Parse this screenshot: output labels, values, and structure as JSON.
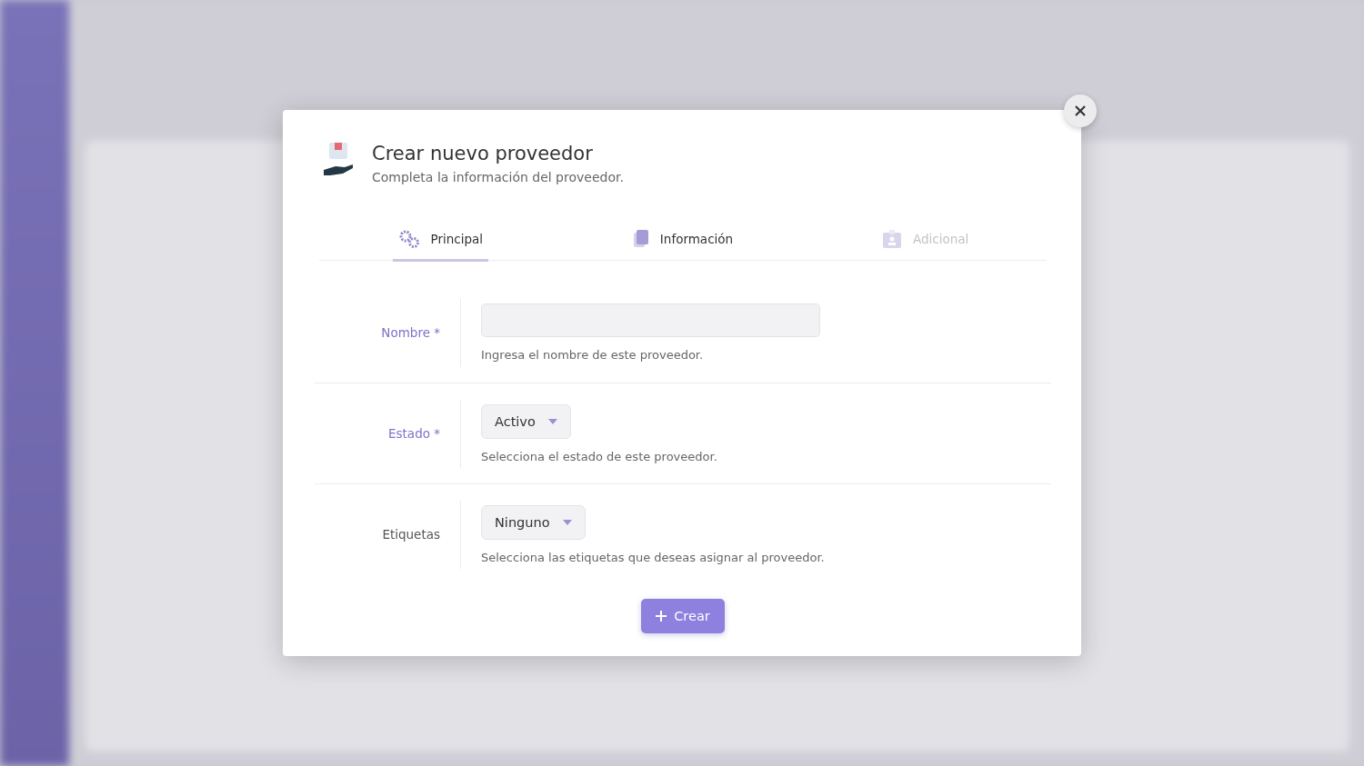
{
  "dialog": {
    "title": "Crear nuevo proveedor",
    "subtitle": "Completa la información del proveedor."
  },
  "tabs": [
    {
      "label": "Principal",
      "kind": "gears",
      "selected": true,
      "disabled": false
    },
    {
      "label": "Información",
      "kind": "document",
      "selected": false,
      "disabled": false
    },
    {
      "label": "Adicional",
      "kind": "badge",
      "selected": false,
      "disabled": true
    }
  ],
  "fields": [
    {
      "kind": "text",
      "label": "Nombre *",
      "required": true,
      "help": "Ingresa el nombre de este proveedor."
    },
    {
      "kind": "select",
      "label": "Estado *",
      "required": true,
      "value": "Activo",
      "help": "Selecciona el estado de este proveedor."
    },
    {
      "kind": "select",
      "label": "Etiquetas",
      "required": false,
      "value": "Ninguno",
      "help": "Selecciona las etiquetas que deseas asignar al proveedor."
    }
  ],
  "submit_button": {
    "label": "Crear"
  }
}
